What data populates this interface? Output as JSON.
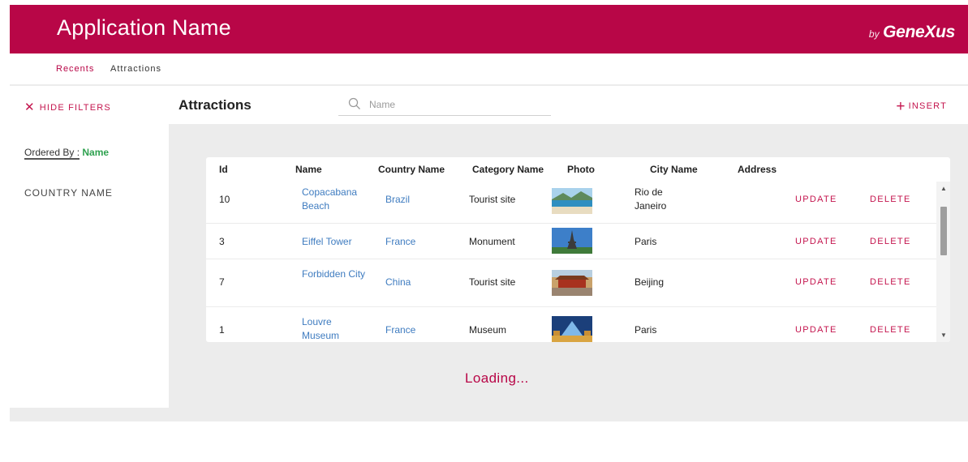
{
  "header": {
    "app_title": "Application Name",
    "brand_by": "by",
    "brand_name": "GeneXus"
  },
  "breadcrumb": {
    "items": [
      "Recents",
      "Attractions"
    ]
  },
  "toolbar": {
    "hide_filters_label": "HIDE FILTERS",
    "page_title": "Attractions",
    "search_placeholder": "Name",
    "search_value": "",
    "insert_label": "INSERT"
  },
  "filters": {
    "ordered_by_label": "Ordered By :",
    "ordered_by_value": "Name",
    "country_filter_label": "COUNTRY NAME"
  },
  "grid": {
    "columns": [
      "Id",
      "Name",
      "Country Name",
      "Category Name",
      "Photo",
      "City Name",
      "Address"
    ],
    "rows": [
      {
        "id": "10",
        "name": "Copacabana Beach",
        "country": "Brazil",
        "category": "Tourist site",
        "photo_icon": "beach-photo",
        "city": "Rio de Janeiro",
        "address": "",
        "update": "UPDATE",
        "delete": "DELETE"
      },
      {
        "id": "3",
        "name": "Eiffel Tower",
        "country": "France",
        "category": "Monument",
        "photo_icon": "eiffel-tower-photo",
        "city": "Paris",
        "address": "",
        "update": "UPDATE",
        "delete": "DELETE"
      },
      {
        "id": "7",
        "name": "Forbidden City",
        "country": "China",
        "category": "Tourist site",
        "photo_icon": "forbidden-city-photo",
        "city": "Beijing",
        "address": "",
        "update": "UPDATE",
        "delete": "DELETE"
      },
      {
        "id": "1",
        "name": "Louvre Museum",
        "country": "France",
        "category": "Museum",
        "photo_icon": "louvre-photo",
        "city": "Paris",
        "address": "",
        "update": "UPDATE",
        "delete": "DELETE"
      }
    ]
  },
  "status": {
    "loading": "Loading..."
  },
  "colors": {
    "brand": "#b80647",
    "link": "#3f7cc0",
    "accent_green": "#2ea14f",
    "action": "#c4154e"
  }
}
